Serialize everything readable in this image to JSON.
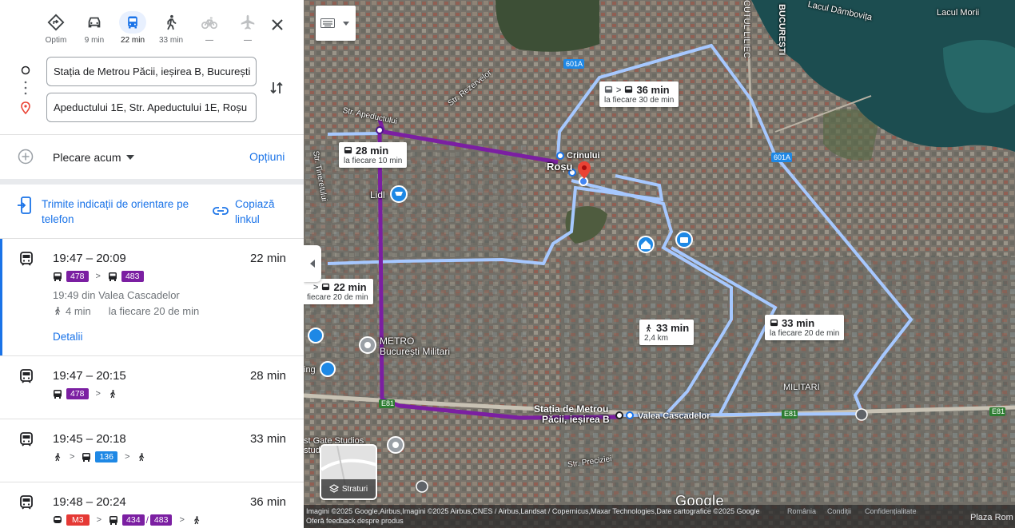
{
  "modes": [
    {
      "name": "optim",
      "label": "Optim",
      "icon": "diamond-directions-icon"
    },
    {
      "name": "car",
      "label": "9 min",
      "icon": "car-icon"
    },
    {
      "name": "transit",
      "label": "22 min",
      "icon": "bus-icon",
      "active": true
    },
    {
      "name": "walk",
      "label": "33 min",
      "icon": "walk-icon"
    },
    {
      "name": "bike",
      "label": "—",
      "icon": "bike-icon"
    },
    {
      "name": "flight",
      "label": "—",
      "icon": "plane-icon"
    }
  ],
  "origin": "Stația de Metrou Păcii, ieșirea B, București",
  "destination": "Apeductului 1E, Str. Apeductului 1E, Roșu",
  "departure": {
    "label": "Plecare acum",
    "options": "Opțiuni"
  },
  "share": {
    "send": "Trimite indicații de orientare pe telefon",
    "copy": "Copiază linkul"
  },
  "routes": [
    {
      "time": "19:47 – 20:09",
      "duration": "22 min",
      "lines": [
        "478",
        "483"
      ],
      "detail1": "19:49 din Valea Cascadelor",
      "walk": "4 min",
      "freq": "la fiecare 20 de min",
      "details": "Detalii"
    },
    {
      "time": "19:47 – 20:15",
      "duration": "28 min",
      "lines": [
        "478"
      ]
    },
    {
      "time": "19:45 – 20:18",
      "duration": "33 min",
      "lines": [
        "136"
      ]
    },
    {
      "time": "19:48 – 20:24",
      "duration": "36 min",
      "lines": [
        "M3",
        "434",
        "483"
      ]
    }
  ],
  "map": {
    "labels": {
      "dambovita": "Lacul Dâmbovița",
      "morii": "Lacul Morii",
      "bucuresti": "BUCUREȘTI",
      "lilieci": "CUTUL LILIEC",
      "rosu": "Roșu",
      "crinului": "Crinului",
      "lidl": "Lidl",
      "metro": "METRO",
      "bucmilitari": "București Militari",
      "statia1": "Stația de Metrou",
      "statia2": "Păcii, ieșirea B",
      "valea": "Valea Cascadelor",
      "militari": "MILITARI",
      "ing": "ing",
      "eastgate1": "st Gate Studios",
      "eastgate2": "studi",
      "apeductului": "Str. Apeductului",
      "rezervelor": "Str. Rezervelor",
      "tineretului": "Str. Tineretului",
      "preciziei": "Str. Preciziei",
      "r601a_1": "601A",
      "r601a_2": "601A",
      "e81_1": "E81",
      "e81_2": "E81",
      "e81_3": "E81"
    },
    "cards": {
      "c36": {
        "title": "36 min",
        "sub": "la fiecare 30 de min"
      },
      "c28": {
        "title": "28 min",
        "sub": "la fiecare 10 min"
      },
      "c22": {
        "title": "22 min",
        "sub": "fiecare 20 de min"
      },
      "c33w": {
        "title": "33 min",
        "sub": "2,4 km"
      },
      "c33b": {
        "title": "33 min",
        "sub": "la fiecare 20 de min"
      }
    },
    "layers": "Straturi",
    "google": "Google",
    "footer": {
      "attribution": "Imagini ©2025 Google,Airbus,Imagini ©2025 Airbus,CNES / Airbus,Landsat / Copernicus,Maxar Technologies,Date cartografice ©2025 Google",
      "romania": "România",
      "conditii": "Condiții",
      "conf": "Confidențialitate",
      "feedback": "Oferă feedback despre produs",
      "plaza": "Plaza Rom"
    },
    "colors": {
      "primary_route": "#7b1fa2",
      "alt_route": "#a6c8ff"
    }
  }
}
